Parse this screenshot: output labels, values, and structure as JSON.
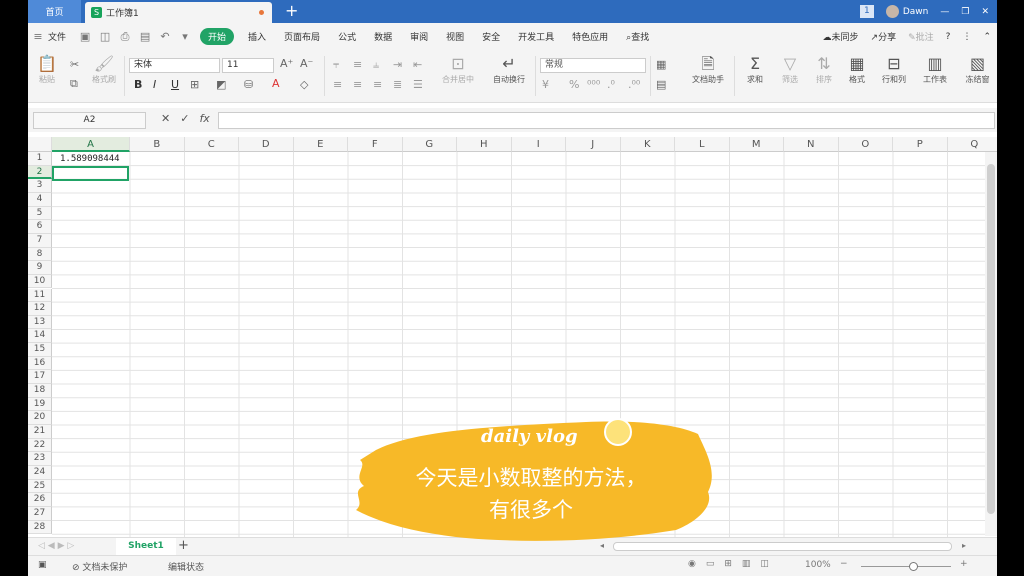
{
  "titlebar": {
    "home_tab": "首页",
    "doc_tab": "工作簿1",
    "doc_icon": "S",
    "add": "+",
    "user": "Dawn",
    "badge": "1"
  },
  "menubar": {
    "file": "文件",
    "items": [
      "开始",
      "插入",
      "页面布局",
      "公式",
      "数据",
      "审阅",
      "视图",
      "安全",
      "开发工具",
      "特色应用"
    ],
    "search": "查找",
    "sync": "未同步",
    "share": "分享",
    "comment": "批注",
    "help": "?"
  },
  "ribbon": {
    "paste": "粘贴",
    "format_painter": "格式刷",
    "font_name": "宋体",
    "font_size": "11",
    "merge": "合并居中",
    "wrap": "自动换行",
    "number_format": "常规",
    "doc_assistant": "文档助手",
    "sum": "求和",
    "filter": "筛选",
    "sort": "排序",
    "format": "格式",
    "row_col": "行和列",
    "worksheet": "工作表",
    "freeze": "冻结窗"
  },
  "formula": {
    "name_box": "A2",
    "fx": "fx",
    "value": ""
  },
  "grid": {
    "columns": [
      "A",
      "B",
      "C",
      "D",
      "E",
      "F",
      "G",
      "H",
      "I",
      "J",
      "K",
      "L",
      "M",
      "N",
      "O",
      "P",
      "Q"
    ],
    "rows": [
      "1",
      "2",
      "3",
      "4",
      "5",
      "6",
      "7",
      "8",
      "9",
      "10",
      "11",
      "12",
      "13",
      "14",
      "15",
      "16",
      "17",
      "18",
      "19",
      "20",
      "21",
      "22",
      "23",
      "24",
      "25",
      "26",
      "27",
      "28"
    ],
    "A1": "1.589098444"
  },
  "sheets": {
    "active": "Sheet1",
    "add": "+"
  },
  "status": {
    "protect": "文档未保护",
    "mode": "编辑状态",
    "zoom": "100%"
  },
  "overlay": {
    "title": "daily vlog",
    "line1": "今天是小数取整的方法，",
    "line2": "有很多个",
    "brush_color": "#f7b928"
  }
}
